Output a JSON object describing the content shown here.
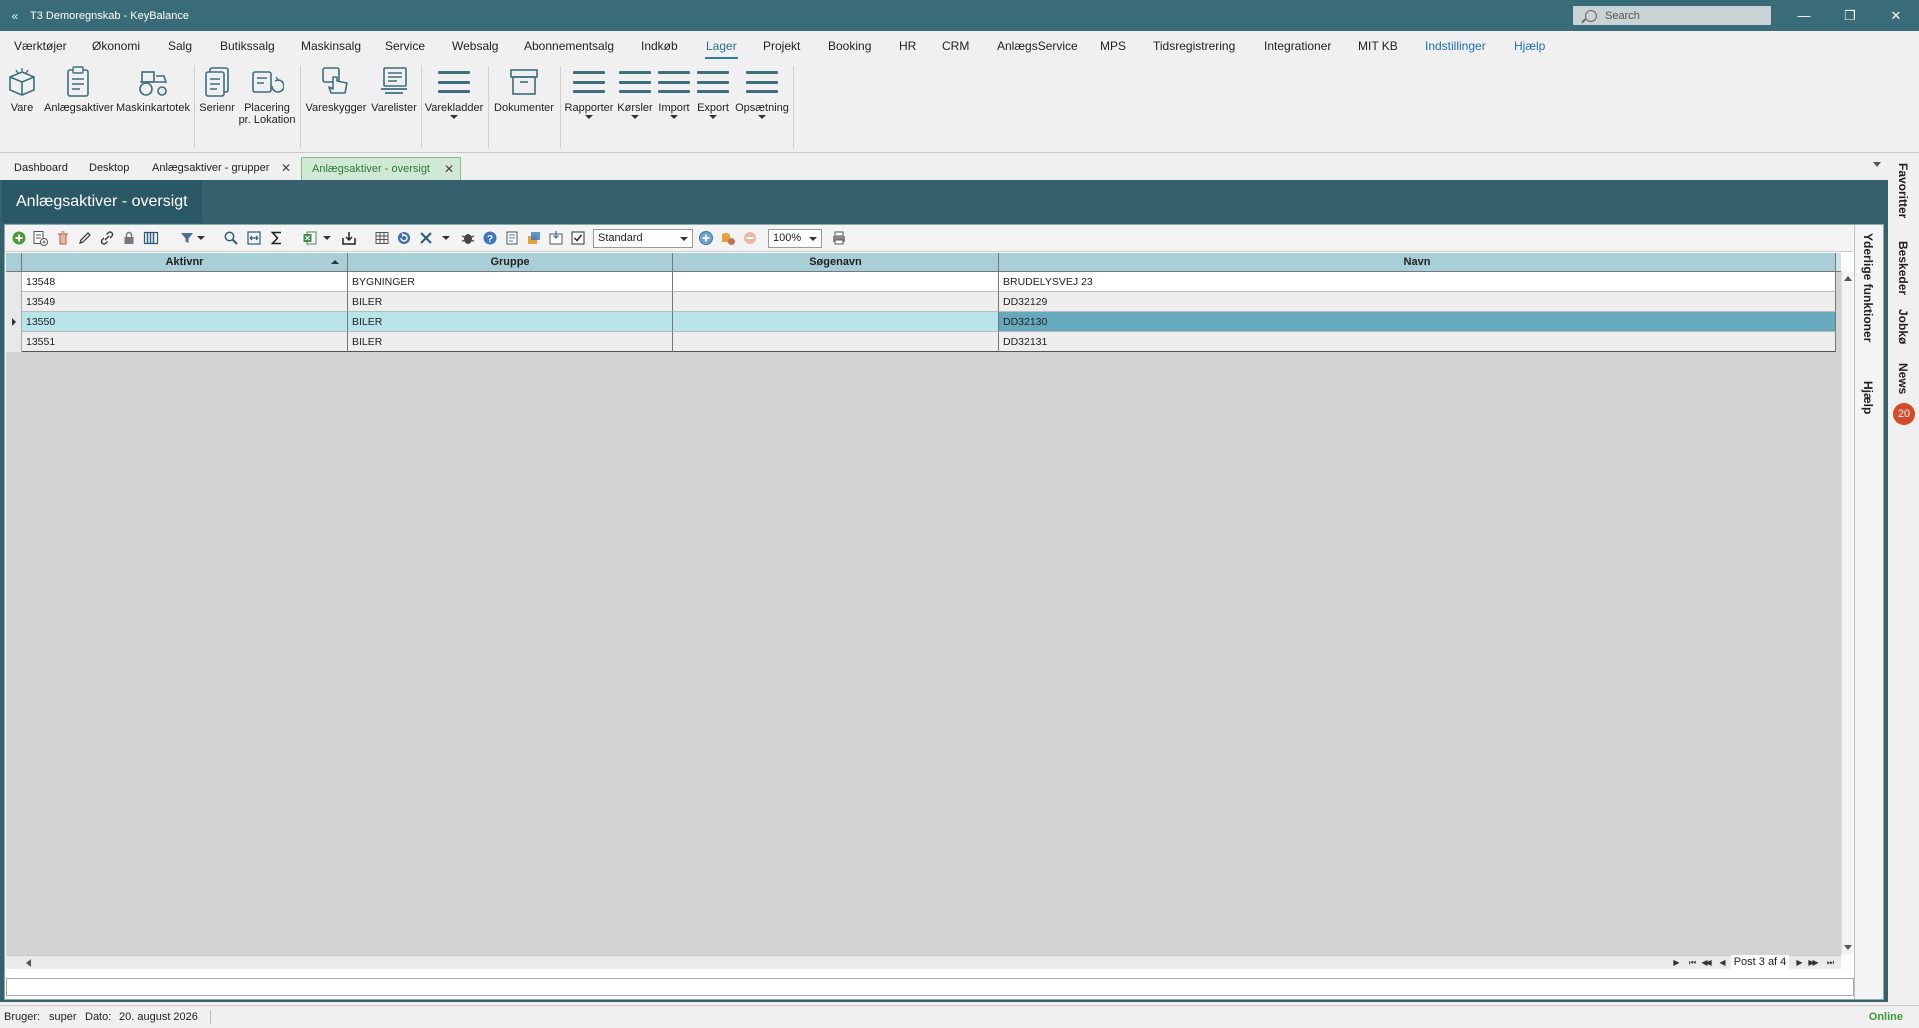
{
  "window": {
    "title": "T3 Demoregnskab - KeyBalance",
    "search_placeholder": "Search",
    "minimize": "—",
    "restore": "❐",
    "close": "✕"
  },
  "menu": {
    "items": [
      "Værktøjer",
      "Økonomi",
      "Salg",
      "Butikssalg",
      "Maskinsalg",
      "Service",
      "Websalg",
      "Abonnementsalg",
      "Indkøb",
      "Lager",
      "Projekt",
      "Booking",
      "HR",
      "CRM",
      "AnlægsService",
      "MPS",
      "Tidsregistrering",
      "Integrationer",
      "MIT KB",
      "Indstillinger",
      "Hjælp"
    ],
    "active": "Lager"
  },
  "ribbon": {
    "vare": "Vare",
    "anlaegsaktiver": "Anlægsaktiver",
    "maskinkartotek": "Maskinkartotek",
    "serienr": "Serienr",
    "placering_1": "Placering",
    "placering_2": "pr. Lokation",
    "vareskygger": "Vareskygger",
    "varelister": "Varelister",
    "varekladder": "Varekladder",
    "dokumenter": "Dokumenter",
    "rapporter": "Rapporter",
    "korsler": "Kørsler",
    "import": "Import",
    "export": "Export",
    "opsaetning": "Opsætning"
  },
  "tabs": {
    "dashboard": "Dashboard",
    "desktop": "Desktop",
    "grupper": "Anlægsaktiver - grupper",
    "oversigt": "Anlægsaktiver - oversigt"
  },
  "page": {
    "title": "Anlægsaktiver - oversigt"
  },
  "toolbar": {
    "layout_value": "Standard",
    "zoom_value": "100%"
  },
  "grid": {
    "columns": [
      "Aktivnr",
      "Gruppe",
      "Søgenavn",
      "Navn"
    ],
    "rows": [
      {
        "aktivnr": "13548",
        "gruppe": "BYGNINGER",
        "soegenavn": "",
        "navn": "BRUDELYSVEJ 23"
      },
      {
        "aktivnr": "13549",
        "gruppe": "BILER",
        "soegenavn": "",
        "navn": "DD32129"
      },
      {
        "aktivnr": "13550",
        "gruppe": "BILER",
        "soegenavn": "",
        "navn": "DD32130"
      },
      {
        "aktivnr": "13551",
        "gruppe": "BILER",
        "soegenavn": "",
        "navn": "DD32131"
      }
    ],
    "selected_row": 2,
    "page_info": "Post 3 af 4"
  },
  "side_inner": {
    "yderlige": "Yderlige funktioner",
    "hjaelp": "Hjælp"
  },
  "side_outer": {
    "favoritter": "Favoritter",
    "beskeder": "Beskeder",
    "jobkoe": "Jobkø",
    "news": "News",
    "news_count": "20"
  },
  "status": {
    "user_label": "Bruger:",
    "user": "super",
    "date_label": "Dato:",
    "date": "20. august 2026",
    "online": "Online"
  },
  "colors": {
    "titlebar": "#3a6b78",
    "panel": "#36606c",
    "header": "#a8cfd8",
    "selected_row": "#b9e4ea",
    "focused_cell": "#67a9bc",
    "active_tab": "#cfe9d5",
    "online": "#3a9b36"
  }
}
